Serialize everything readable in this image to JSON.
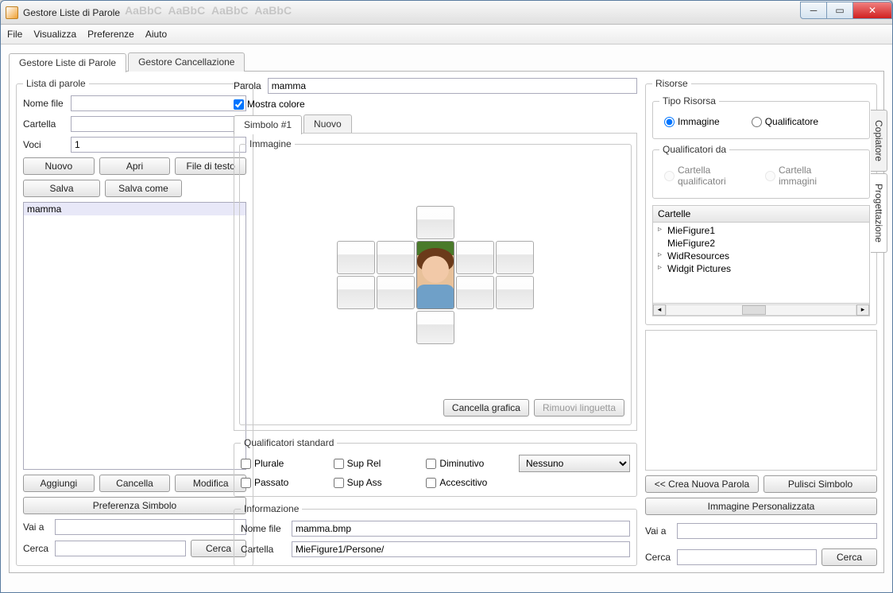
{
  "window": {
    "title": "Gestore Liste di Parole"
  },
  "menu": {
    "file": "File",
    "view": "Visualizza",
    "prefs": "Preferenze",
    "help": "Aiuto"
  },
  "mainTabs": {
    "t1": "Gestore Liste di Parole",
    "t2": "Gestore Cancellazione"
  },
  "sideTabs": {
    "copiatore": "Copiatore",
    "progettazione": "Progettazione"
  },
  "left": {
    "legend": "Lista di parole",
    "labels": {
      "file": "Nome file",
      "folder": "Cartella",
      "voci": "Voci"
    },
    "values": {
      "file": "",
      "folder": "",
      "voci": "1"
    },
    "buttons": {
      "nuovo": "Nuovo",
      "apri": "Apri",
      "filetesto": "File di testo",
      "salva": "Salva",
      "salvacome": "Salva come",
      "aggiungi": "Aggiungi",
      "cancella": "Cancella",
      "modifica": "Modifica",
      "pref": "Preferenza Simbolo"
    },
    "listItems": [
      "mamma"
    ],
    "go": {
      "vai": "Vai a",
      "cerca": "Cerca",
      "btn": "Cerca"
    }
  },
  "mid": {
    "parolaLabel": "Parola",
    "parolaValue": "mamma",
    "mostra": "Mostra colore",
    "mostraChecked": true,
    "symbolTabs": {
      "t1": "Simbolo #1",
      "t2": "Nuovo"
    },
    "immagine": "Immagine",
    "cancGraf": "Cancella grafica",
    "rimLing": "Rimuovi linguetta",
    "qual": {
      "legend": "Qualificatori standard",
      "plurale": "Plurale",
      "suprel": "Sup Rel",
      "diminutivo": "Diminutivo",
      "passato": "Passato",
      "supass": "Sup Ass",
      "accescitivo": "Accescitivo",
      "dropdown": "Nessuno"
    },
    "info": {
      "legend": "Informazione",
      "labels": {
        "file": "Nome file",
        "folder": "Cartella"
      },
      "values": {
        "file": "mamma.bmp",
        "folder": "MieFigure1/Persone/"
      }
    }
  },
  "right": {
    "risorse": "Risorse",
    "tipo": {
      "legend": "Tipo Risorsa",
      "immagine": "Immagine",
      "qualificatore": "Qualificatore",
      "selected": "immagine"
    },
    "qualDa": {
      "legend": "Qualificatori da",
      "opt1": "Cartella qualificatori",
      "opt2": "Cartella immagini"
    },
    "cartelle": "Cartelle",
    "treeItems": [
      "MieFigure1",
      "MieFigure2",
      "WidResources",
      "Widgit Pictures"
    ],
    "buttons": {
      "crea": "<< Crea Nuova Parola",
      "pulisci": "Pulisci Simbolo",
      "custom": "Immagine Personalizzata",
      "cerca": "Cerca"
    },
    "go": {
      "vai": "Vai a",
      "cerca": "Cerca"
    }
  }
}
